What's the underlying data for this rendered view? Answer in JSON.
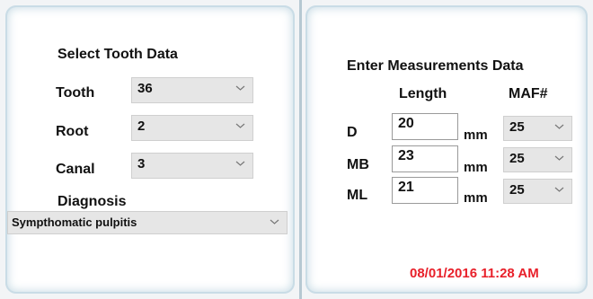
{
  "tooth_panel": {
    "title": "Select Tooth Data",
    "tooth": {
      "label": "Tooth",
      "value": "36"
    },
    "root": {
      "label": "Root",
      "value": "2"
    },
    "canal": {
      "label": "Canal",
      "value": "3"
    },
    "diagnosis": {
      "label": "Diagnosis",
      "value": "Sympthomatic pulpitis"
    }
  },
  "measurement_panel": {
    "title": "Enter Measurements Data",
    "length_header": "Length",
    "maf_header": "MAF#",
    "unit": "mm",
    "rows": [
      {
        "canal": "D",
        "length": "20",
        "maf": "25"
      },
      {
        "canal": "MB",
        "length": "23",
        "maf": "25"
      },
      {
        "canal": "ML",
        "length": "21",
        "maf": "25"
      }
    ],
    "timestamp": "08/01/2016 11:28 AM"
  },
  "icons": {
    "dropdown": "chevron-down-icon"
  },
  "colors": {
    "timestamp": "#e8202a",
    "dropdown_bg": "#e6e6e6"
  }
}
